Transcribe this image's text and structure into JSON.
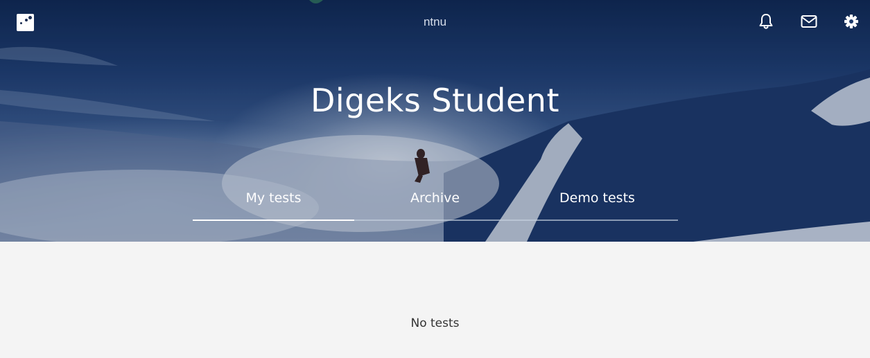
{
  "header": {
    "org_name": "ntnu",
    "icons": [
      "logo-icon",
      "bell-icon",
      "mail-icon",
      "gear-icon"
    ]
  },
  "hero": {
    "title": "Digeks Student"
  },
  "tabs": [
    {
      "label": "My tests",
      "active": true
    },
    {
      "label": "Archive",
      "active": false
    },
    {
      "label": "Demo tests",
      "active": false
    }
  ],
  "content": {
    "empty_message": "No tests"
  },
  "colors": {
    "accent": "#ffffff",
    "background": "#f4f4f4",
    "hero_dark": "#0f2750"
  }
}
